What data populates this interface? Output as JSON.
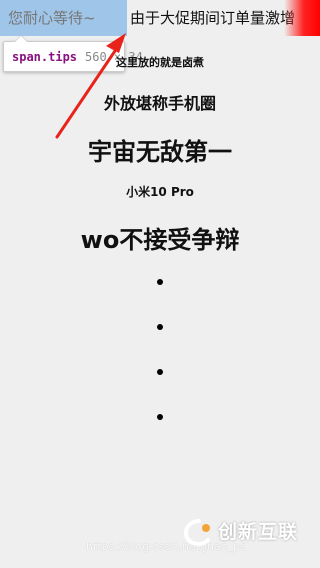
{
  "banner": {
    "segment_1": "您耐心等待~",
    "segment_2": "由于大促期间订单量激增"
  },
  "devtools_tooltip": {
    "selector": "span.tips",
    "size": "560 × 34"
  },
  "content": {
    "line_1": "这里放的就是卤煮",
    "line_2": "外放堪称手机圈",
    "line_3": "宇宙无敌第一",
    "line_4": "小米10 Pro",
    "line_5": "wo不接受争辩"
  },
  "list": {
    "bullets": [
      "",
      "",
      "",
      ""
    ]
  },
  "watermark": {
    "url": "https://blog.csdn.net/Jhan_pc",
    "logo_text": "创新互联"
  },
  "colors": {
    "highlight": "#9fc5e8",
    "arrow": "#e8231c",
    "tooltip_tag": "#881280"
  }
}
